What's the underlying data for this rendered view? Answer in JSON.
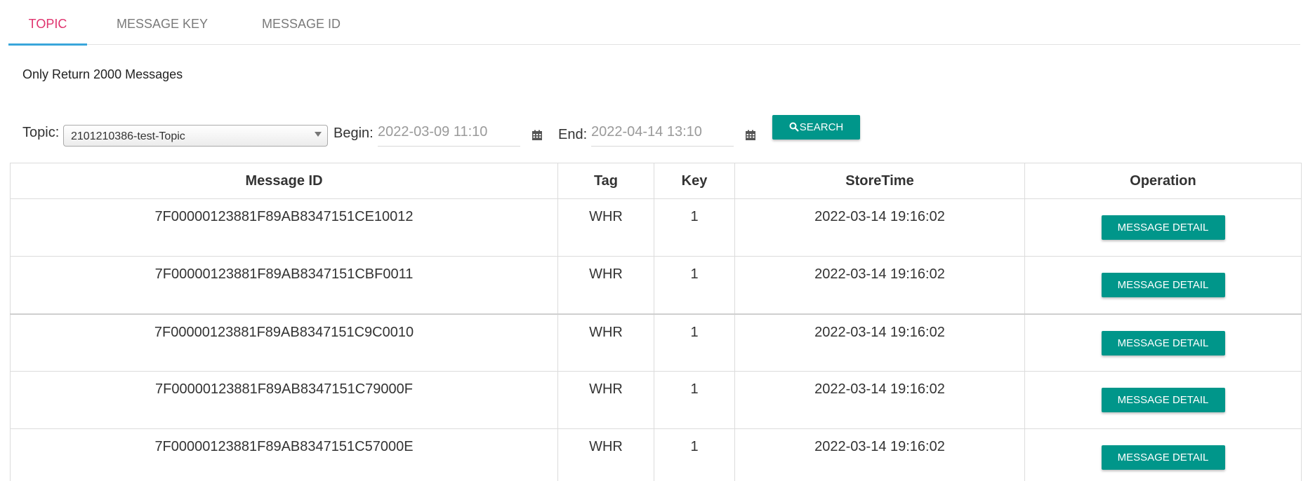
{
  "tabs": [
    {
      "label": "TOPIC",
      "active": true
    },
    {
      "label": "MESSAGE KEY",
      "active": false
    },
    {
      "label": "MESSAGE ID",
      "active": false
    }
  ],
  "note": "Only Return 2000 Messages",
  "form": {
    "topic_label": "Topic:",
    "topic_value": "2101210386-test-Topic",
    "begin_label": "Begin:",
    "begin_value": "2022-03-09 11:10",
    "end_label": "End:",
    "end_value": "2022-04-14 13:10",
    "search_label": "SEARCH"
  },
  "table": {
    "headers": [
      "Message ID",
      "Tag",
      "Key",
      "StoreTime",
      "Operation"
    ],
    "rows": [
      {
        "id": "7F00000123881F89AB8347151CE10012",
        "tag": "WHR",
        "key": "1",
        "time": "2022-03-14 19:16:02",
        "action": "MESSAGE DETAIL"
      },
      {
        "id": "7F00000123881F89AB8347151CBF0011",
        "tag": "WHR",
        "key": "1",
        "time": "2022-03-14 19:16:02",
        "action": "MESSAGE DETAIL"
      },
      {
        "id": "7F00000123881F89AB8347151C9C0010",
        "tag": "WHR",
        "key": "1",
        "time": "2022-03-14 19:16:02",
        "action": "MESSAGE DETAIL"
      },
      {
        "id": "7F00000123881F89AB8347151C79000F",
        "tag": "WHR",
        "key": "1",
        "time": "2022-03-14 19:16:02",
        "action": "MESSAGE DETAIL"
      },
      {
        "id": "7F00000123881F89AB8347151C57000E",
        "tag": "WHR",
        "key": "1",
        "time": "2022-03-14 19:16:02",
        "action": "MESSAGE DETAIL"
      }
    ]
  },
  "colors": {
    "accent": "#00968a",
    "active_tab_text": "#e0336e",
    "active_tab_underline": "#3aa6db"
  },
  "icons": {
    "calendar": "calendar-icon",
    "search": "search-icon",
    "dropdown": "chevron-down-icon"
  }
}
